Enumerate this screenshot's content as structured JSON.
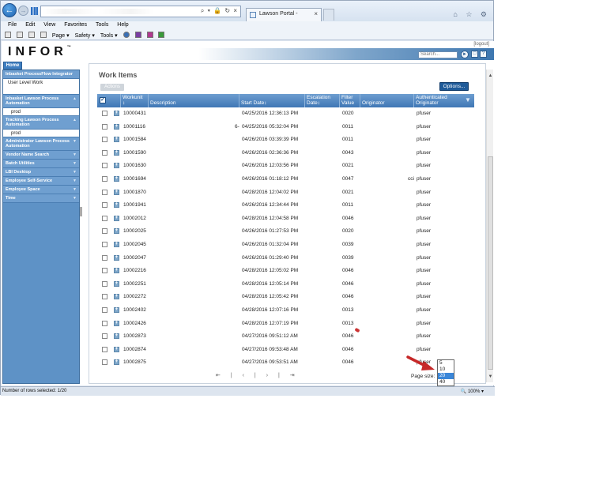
{
  "browser": {
    "back_icon": "back-arrow-icon",
    "forward_icon": "forward-arrow-icon",
    "address_controls": "⌕ ▾ 🔒 ↻ ×",
    "tab_title": "Lawson Portal -",
    "tab_close": "×",
    "window_tools": "⌂ ☆ ⚙",
    "menu": [
      "File",
      "Edit",
      "View",
      "Favorites",
      "Tools",
      "Help"
    ],
    "command_bar": [
      "Page ▾",
      "Safety ▾",
      "Tools ▾"
    ],
    "status_text": "Number of rows selected: 1/20",
    "zoom": "🔍 100% ▾"
  },
  "portal": {
    "logo": "INFOR",
    "logo_tm": "™",
    "logout": "[logout]",
    "search_placeholder": "Search...",
    "home_tab": "Home",
    "sidebar": [
      {
        "title": "Inbasket ProcessFlow Integrator",
        "items": [
          "User Level Work"
        ]
      },
      {
        "title": "Inbasket Lawson Process Automation",
        "items": [
          "prod"
        ]
      },
      {
        "title": "Tracking Lawson Process Automation",
        "items": [
          "prod"
        ]
      },
      {
        "title": "Administrator Lawson Process Automation",
        "items": []
      },
      {
        "title": "Vendor Name Search",
        "items": []
      },
      {
        "title": "Batch Utilities",
        "items": []
      },
      {
        "title": "LBI Desktop",
        "items": []
      },
      {
        "title": "Employee Self-Service",
        "items": []
      },
      {
        "title": "Employee Space",
        "items": []
      },
      {
        "title": "Time",
        "items": []
      }
    ]
  },
  "work_items": {
    "title": "Work Items",
    "actions_label": "Actions",
    "options_label": "Options...",
    "columns": {
      "workunit": "Workunit",
      "workunit_sort": "↕",
      "description": "Description",
      "start_date": "Start Date↕",
      "escalation_date": "Escalation Date↕",
      "filter_value": "Filter Value",
      "originator": "Originator",
      "authenticated_originator": "Authenticated Originator"
    },
    "rows": [
      {
        "workunit": "10000431",
        "desc": "",
        "start": "04/25/2016 12:36:13 PM",
        "filter": "0020",
        "orig": "",
        "auth": "pfuser"
      },
      {
        "workunit": "10001116",
        "desc": "6-",
        "start": "04/25/2016 05:32:04 PM",
        "filter": "0011",
        "orig": "",
        "auth": "pfuser"
      },
      {
        "workunit": "10001584",
        "desc": "",
        "start": "04/26/2016 03:39:39 PM",
        "filter": "0011",
        "orig": "",
        "auth": "pfuser"
      },
      {
        "workunit": "10001590",
        "desc": "",
        "start": "04/26/2016 02:36:36 PM",
        "filter": "0043",
        "orig": "",
        "auth": "pfuser"
      },
      {
        "workunit": "10001630",
        "desc": "",
        "start": "04/26/2016 12:03:56 PM",
        "filter": "0021",
        "orig": "",
        "auth": "pfuser"
      },
      {
        "workunit": "10001694",
        "desc": "",
        "start": "04/26/2016 01:18:12 PM",
        "filter": "0047",
        "orig": "cci",
        "auth": "pfuser"
      },
      {
        "workunit": "10001870",
        "desc": "",
        "start": "04/28/2016 12:04:02 PM",
        "filter": "0021",
        "orig": "",
        "auth": "pfuser"
      },
      {
        "workunit": "10001941",
        "desc": "",
        "start": "04/26/2016 12:34:44 PM",
        "filter": "0011",
        "orig": "",
        "auth": "pfuser"
      },
      {
        "workunit": "10002012",
        "desc": "",
        "start": "04/28/2016 12:04:58 PM",
        "filter": "0046",
        "orig": "",
        "auth": "pfuser"
      },
      {
        "workunit": "10002025",
        "desc": "",
        "start": "04/26/2016 01:27:53 PM",
        "filter": "0020",
        "orig": "",
        "auth": "pfuser"
      },
      {
        "workunit": "10002045",
        "desc": "",
        "start": "04/26/2016 01:32:04 PM",
        "filter": "0039",
        "orig": "",
        "auth": "pfuser"
      },
      {
        "workunit": "10002047",
        "desc": "",
        "start": "04/26/2016 01:29:40 PM",
        "filter": "0039",
        "orig": "",
        "auth": "pfuser"
      },
      {
        "workunit": "10002216",
        "desc": "",
        "start": "04/28/2016 12:05:02 PM",
        "filter": "0046",
        "orig": "",
        "auth": "pfuser"
      },
      {
        "workunit": "10002251",
        "desc": "",
        "start": "04/28/2016 12:05:14 PM",
        "filter": "0046",
        "orig": "",
        "auth": "pfuser"
      },
      {
        "workunit": "10002272",
        "desc": "",
        "start": "04/28/2016 12:05:42 PM",
        "filter": "0046",
        "orig": "",
        "auth": "pfuser"
      },
      {
        "workunit": "10002402",
        "desc": "",
        "start": "04/28/2016 12:07:16 PM",
        "filter": "0013",
        "orig": "",
        "auth": "pfuser"
      },
      {
        "workunit": "10002426",
        "desc": "",
        "start": "04/28/2016 12:07:19 PM",
        "filter": "0013",
        "orig": "",
        "auth": "pfuser"
      },
      {
        "workunit": "10002873",
        "desc": "",
        "start": "04/27/2016 09:51:12 AM",
        "filter": "0046",
        "orig": "",
        "auth": "pfuser"
      },
      {
        "workunit": "10002874",
        "desc": "",
        "start": "04/27/2016 09:53:48 AM",
        "filter": "0046",
        "orig": "",
        "auth": "pfuser"
      },
      {
        "workunit": "10002875",
        "desc": "",
        "start": "04/27/2016 09:53:51 AM",
        "filter": "0046",
        "orig": "",
        "auth": "pfuser"
      }
    ],
    "pager": [
      "⇤",
      "|",
      "‹",
      "|",
      "›",
      "|",
      "⇥"
    ],
    "page_size_label": "Page size:",
    "page_size_options": [
      "5",
      "10",
      "20",
      "40"
    ],
    "page_size_selected": "20",
    "accent_color": "#1f5b99",
    "highlight_color": "#3a86d8"
  }
}
